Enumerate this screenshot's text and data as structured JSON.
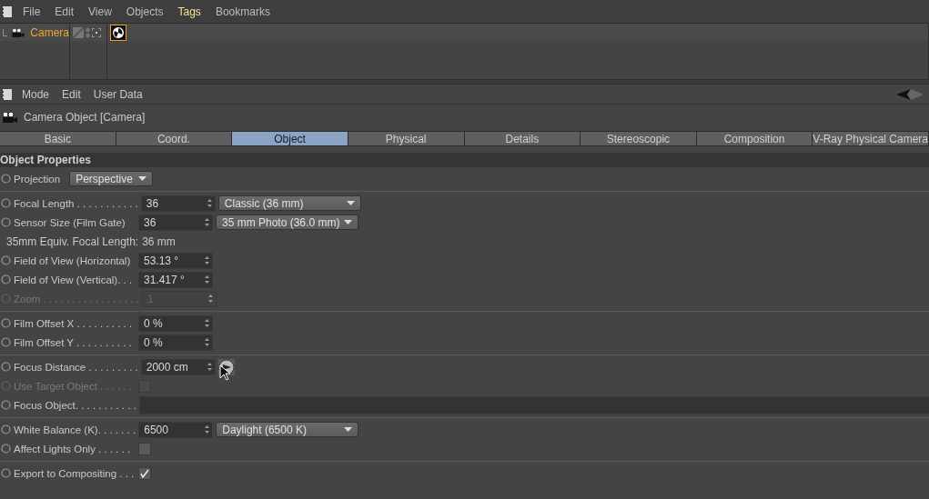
{
  "menu": [
    {
      "label": "File",
      "highlighted": false
    },
    {
      "label": "Edit",
      "highlighted": false
    },
    {
      "label": "View",
      "highlighted": false
    },
    {
      "label": "Objects",
      "highlighted": false
    },
    {
      "label": "Tags",
      "highlighted": true
    },
    {
      "label": "Bookmarks",
      "highlighted": false
    }
  ],
  "object_manager": {
    "objects": [
      {
        "name": "Camera",
        "selected": true,
        "tag_selected": true
      }
    ]
  },
  "attributes": {
    "menu": [
      "Mode",
      "Edit",
      "User Data"
    ],
    "title": "Camera Object [Camera]",
    "tabs": [
      {
        "label": "Basic",
        "selected": false
      },
      {
        "label": "Coord.",
        "selected": false
      },
      {
        "label": "Object",
        "selected": true
      },
      {
        "label": "Physical",
        "selected": false
      },
      {
        "label": "Details",
        "selected": false
      },
      {
        "label": "Stereoscopic",
        "selected": false
      },
      {
        "label": "Composition",
        "selected": false
      },
      {
        "label": "V-Ray Physical Camera",
        "selected": false
      }
    ],
    "section": "Object Properties",
    "groups": [
      [
        {
          "kind": "dropdown",
          "label": "Projection",
          "choice": "Perspective",
          "disabled": false
        }
      ],
      [
        {
          "kind": "number",
          "label": "Focal Length . . . . . . . . . . .",
          "value": "36",
          "choice": "Classic (36 mm)",
          "disabled": false
        },
        {
          "kind": "number",
          "label": "Sensor Size (Film Gate)",
          "value": "36",
          "choice": "35 mm Photo (36.0 mm)",
          "disabled": false
        },
        {
          "kind": "info",
          "label": "35mm Equiv. Focal Length:",
          "value": "36 mm"
        },
        {
          "kind": "number",
          "label": "Field of View (Horizontal)",
          "value": "53.13 °",
          "disabled": false
        },
        {
          "kind": "number",
          "label": "Field of View (Vertical). . .",
          "value": "31.417 °",
          "disabled": false
        },
        {
          "kind": "number",
          "label": "Zoom . . . . . . . . . . . . . . . . .",
          "value": "1",
          "disabled": true
        }
      ],
      [
        {
          "kind": "number",
          "label": "Film Offset X . . . . . . . . . .",
          "value": "0 %",
          "disabled": false
        },
        {
          "kind": "number",
          "label": "Film Offset Y . . . . . . . . . .",
          "value": "0 %",
          "disabled": false
        }
      ],
      [
        {
          "kind": "pick",
          "label": "Focus Distance . . . . . . . . .",
          "value": "2000 cm",
          "disabled": false
        },
        {
          "kind": "checkbox",
          "label": "Use Target Object  . . . . . .",
          "checked": false,
          "disabled": true
        },
        {
          "kind": "link",
          "label": "Focus Object. . . . . . . . . . .",
          "disabled": false
        }
      ],
      [
        {
          "kind": "number",
          "label": "White Balance (K). . . . . . .",
          "value": "6500",
          "choice": "Daylight (6500 K)",
          "disabled": false
        },
        {
          "kind": "checkbox",
          "label": "Affect Lights Only  . . . . . .",
          "checked": false,
          "disabled": false
        }
      ],
      [
        {
          "kind": "checkbox",
          "label": "Export to Compositing . . .",
          "checked": true,
          "disabled": false
        }
      ]
    ]
  }
}
